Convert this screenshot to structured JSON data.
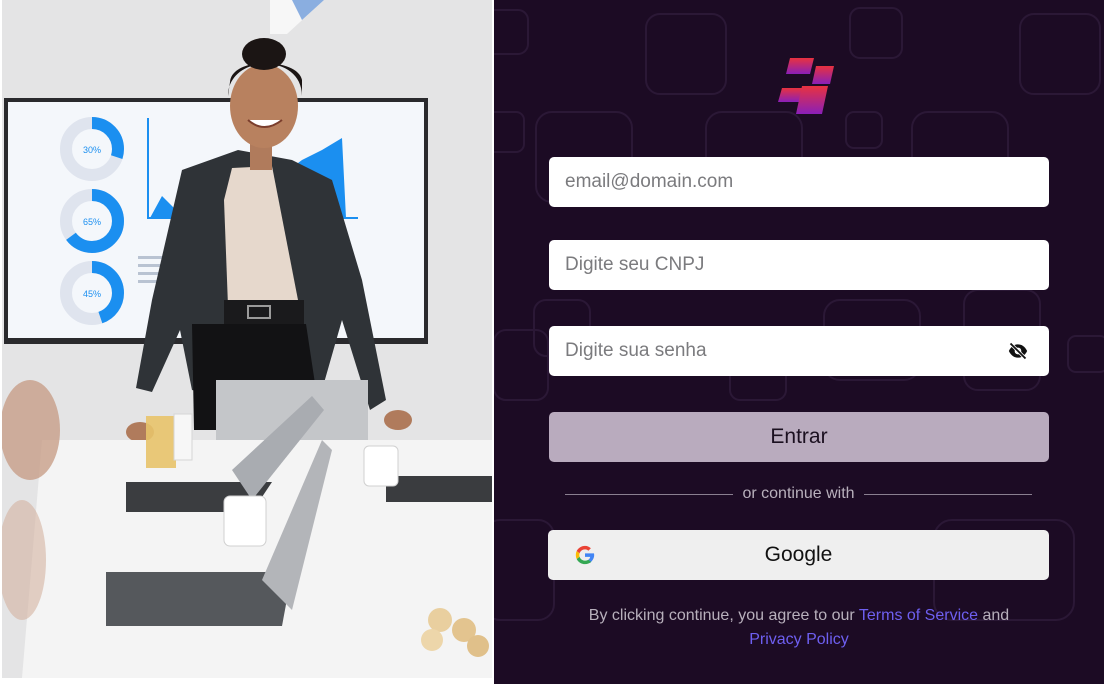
{
  "photo": {
    "donut_labels": [
      "30%",
      "65%",
      "45%"
    ]
  },
  "login": {
    "email_placeholder": "email@domain.com",
    "cnpj_placeholder": "Digite seu CNPJ",
    "password_placeholder": "Digite sua senha",
    "submit_label": "Entrar",
    "divider_text": "or continue with",
    "google_label": "Google",
    "legal_prefix": "By clicking continue, you agree to our",
    "terms_link": "Terms of Service",
    "legal_and": "and",
    "privacy_link": "Privacy Policy"
  },
  "icons": {
    "logo": "brand-logo",
    "password_toggle": "eye-off-icon",
    "google": "google-icon"
  },
  "colors": {
    "panel_bg": "#1c0b24",
    "submit_bg": "#b9abbe",
    "link": "#6e5ff0",
    "logo_top": "#e8323f",
    "logo_bottom": "#8a1fb8"
  }
}
